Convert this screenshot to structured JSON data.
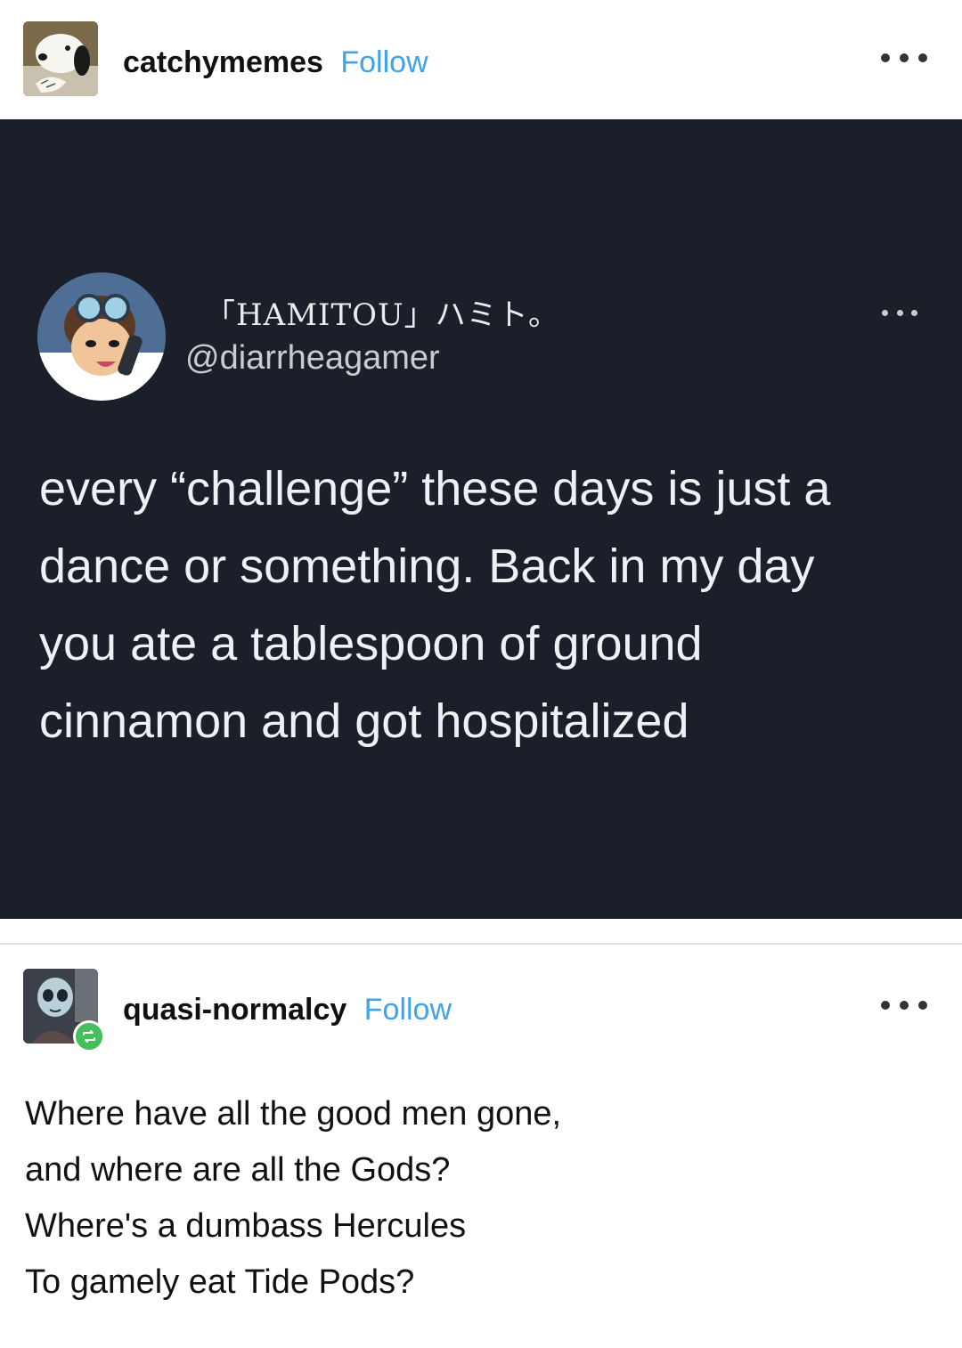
{
  "post": {
    "blog_name": "catchymemes",
    "follow_label": "Follow",
    "avatar_icon": "snoopy-avatar-icon",
    "more_icon": "more-options-icon"
  },
  "tweet": {
    "display_name": "「HAMITOU」ハミト。",
    "handle": "@diarrheagamer",
    "text_lines": [
      "every “challenge” these days is just a",
      "dance or something. Back in my day",
      "you ate a tablespoon of ground",
      "cinnamon and got hospitalized"
    ],
    "colors": {
      "background": "#1b1f29",
      "text": "#eef0f3"
    }
  },
  "reblog": {
    "blog_name": "quasi-normalcy",
    "follow_label": "Follow",
    "avatar_icon": "corpse-bride-avatar-icon",
    "badge_icon": "reblog-icon",
    "body_lines": [
      "Where have all the good men gone,",
      "and where are all the Gods?",
      "Where's a dumbass Hercules",
      "To gamely eat Tide Pods?"
    ]
  },
  "colors": {
    "follow": "#3ea3e8",
    "reblog_badge": "#44bf5a"
  }
}
